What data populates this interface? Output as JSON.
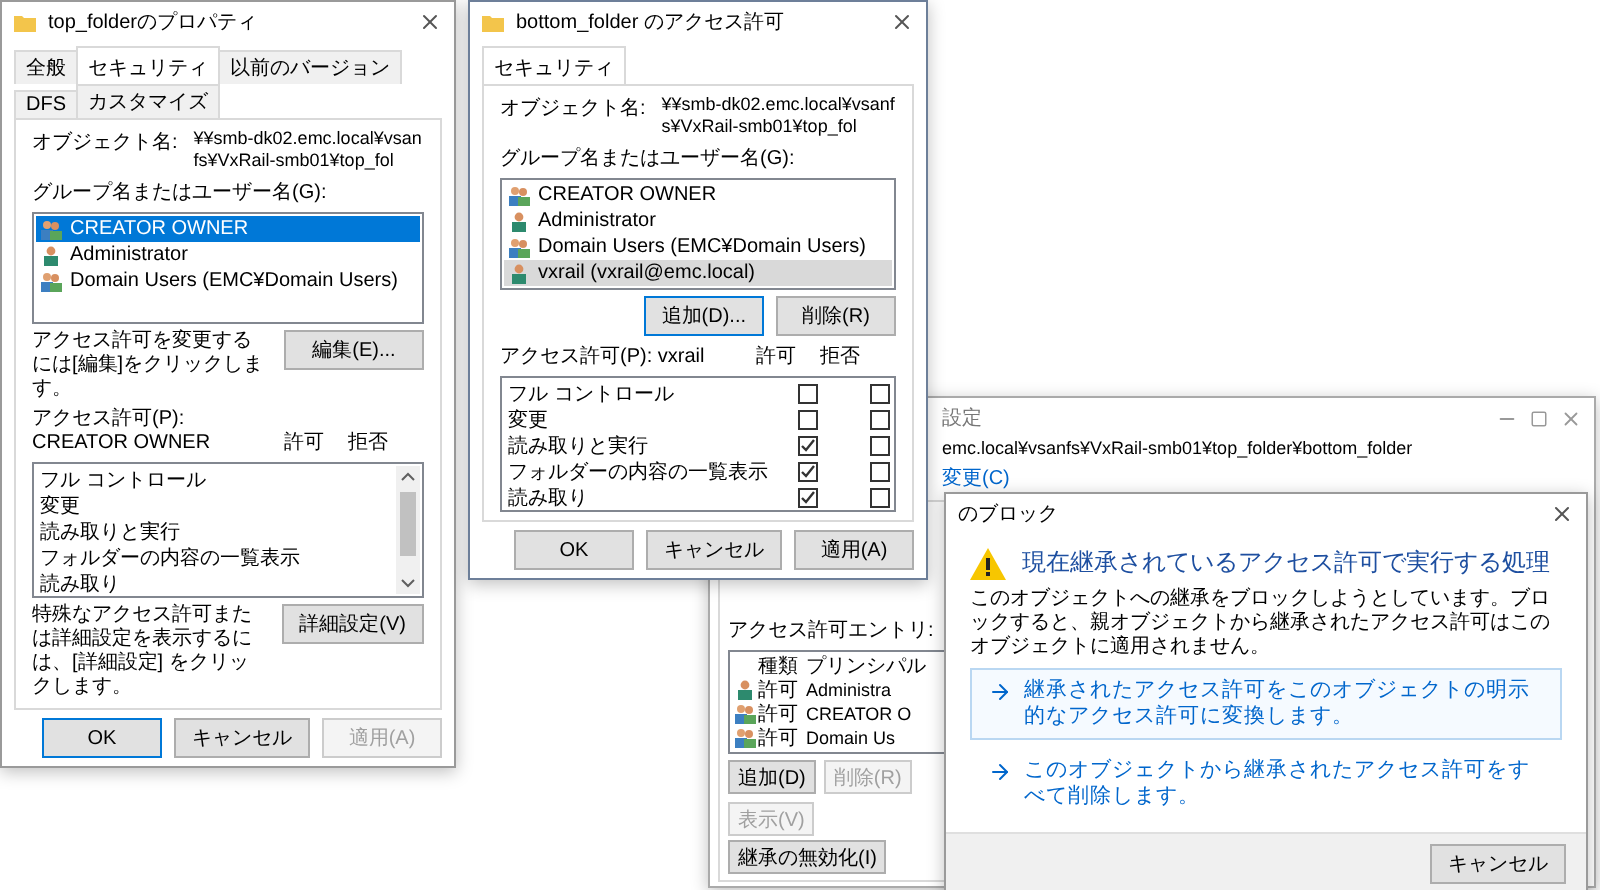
{
  "properties_window": {
    "title": "top_folderのプロパティ",
    "tabs": [
      {
        "label": "全般",
        "selected": false
      },
      {
        "label": "セキュリティ",
        "selected": true
      },
      {
        "label": "以前のバージョン",
        "selected": false
      },
      {
        "label": "DFS",
        "selected": false
      },
      {
        "label": "カスタマイズ",
        "selected": false
      }
    ],
    "object_label": "オブジェクト名:",
    "object_path": "¥¥smb-dk02.emc.local¥vsanfs¥VxRail-smb01¥top_fol",
    "group_label": "グループ名またはユーザー名(G):",
    "list_focused": true,
    "users": [
      {
        "name": "CREATOR OWNER",
        "kind": "group",
        "selected": true
      },
      {
        "name": "Administrator",
        "kind": "user",
        "selected": false
      },
      {
        "name": "Domain Users (EMC¥Domain Users)",
        "kind": "group",
        "selected": false
      }
    ],
    "edit_hint": "アクセス許可を変更するには[編集]をクリックします。",
    "edit_button": "編集(E)...",
    "permissions_label": "アクセス許可(P): CREATOR OWNER",
    "allow_header": "許可",
    "deny_header": "拒否",
    "permissions": [
      {
        "name": "フル コントロール"
      },
      {
        "name": "変更"
      },
      {
        "name": "読み取りと実行"
      },
      {
        "name": "フォルダーの内容の一覧表示"
      },
      {
        "name": "読み取り"
      }
    ],
    "advanced_hint": "特殊なアクセス許可または詳細設定を表示するには、[詳細設定] をクリックします。",
    "advanced_button": "詳細設定(V)",
    "buttons": [
      {
        "label": "OK",
        "focused": true,
        "disabled": false
      },
      {
        "label": "キャンセル",
        "focused": false,
        "disabled": false
      },
      {
        "label": "適用(A)",
        "focused": false,
        "disabled": true
      }
    ]
  },
  "permissions_window": {
    "title": "bottom_folder のアクセス許可",
    "tabs": [
      {
        "label": "セキュリティ",
        "selected": true
      }
    ],
    "object_label": "オブジェクト名:",
    "object_path": "¥¥smb-dk02.emc.local¥vsanfs¥VxRail-smb01¥top_fol",
    "group_label": "グループ名またはユーザー名(G):",
    "list_focused": false,
    "users": [
      {
        "name": "CREATOR OWNER",
        "kind": "group",
        "selected": false
      },
      {
        "name": "Administrator",
        "kind": "user",
        "selected": false
      },
      {
        "name": "Domain Users (EMC¥Domain Users)",
        "kind": "group",
        "selected": false
      },
      {
        "name": "vxrail (vxrail@emc.local)",
        "kind": "user",
        "selected": true
      }
    ],
    "list_buttons": [
      {
        "label": "追加(D)...",
        "focused": true,
        "disabled": false
      },
      {
        "label": "削除(R)",
        "focused": false,
        "disabled": false
      }
    ],
    "permissions_label": "アクセス許可(P): vxrail",
    "allow_header": "許可",
    "deny_header": "拒否",
    "permissions": [
      {
        "name": "フル コントロール",
        "allow": false,
        "deny": false
      },
      {
        "name": "変更",
        "allow": false,
        "deny": false
      },
      {
        "name": "読み取りと実行",
        "allow": true,
        "deny": false
      },
      {
        "name": "フォルダーの内容の一覧表示",
        "allow": true,
        "deny": false
      },
      {
        "name": "読み取り",
        "allow": true,
        "deny": false
      }
    ],
    "buttons": [
      {
        "label": "OK",
        "focused": false,
        "disabled": false
      },
      {
        "label": "キャンセル",
        "focused": false,
        "disabled": false
      },
      {
        "label": "適用(A)",
        "focused": false,
        "disabled": false
      }
    ]
  },
  "advanced_window": {
    "title": "設定",
    "object_path": "emc.local¥vsanfs¥VxRail-smb01¥top_folder¥bottom_folder",
    "change_link": "変更(C)",
    "entries_label": "アクセス許可エントリ:",
    "columns": [
      "種類",
      "プリンシパル"
    ],
    "entries": [
      {
        "kind": "user",
        "type": "許可",
        "principal": "Administra"
      },
      {
        "kind": "group",
        "type": "許可",
        "principal": "CREATOR O"
      },
      {
        "kind": "group",
        "type": "許可",
        "principal": "Domain Us"
      }
    ],
    "buttons": [
      {
        "label": "追加(D)",
        "disabled": false
      },
      {
        "label": "削除(R)",
        "disabled": true
      },
      {
        "label": "表示(V)",
        "disabled": true
      }
    ],
    "inheritance_button": "継承の無効化(I)"
  },
  "block_dialog": {
    "title": "のブロック",
    "heading": "現在継承されているアクセス許可で実行する処理",
    "description": "このオブジェクトへの継承をブロックしようとしています。ブロックすると、親オブジェクトから継承されたアクセス許可はこのオブジェクトに適用されません。",
    "options": [
      {
        "text": "継承されたアクセス許可をこのオブジェクトの明示的なアクセス許可に変換します。",
        "selected": true
      },
      {
        "text": "このオブジェクトから継承されたアクセス許可をすべて削除します。",
        "selected": false
      }
    ],
    "cancel_button": "キャンセル"
  }
}
